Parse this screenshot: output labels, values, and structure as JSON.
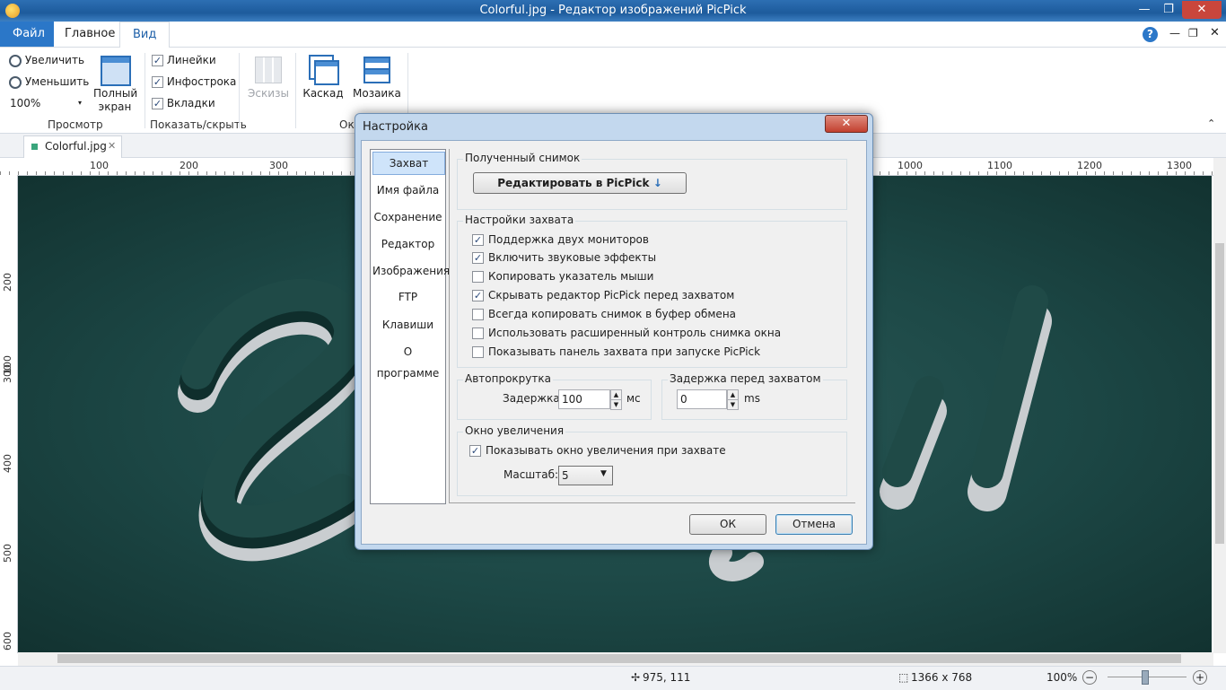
{
  "window": {
    "title": "Colorful.jpg - Редактор изображений PicPick",
    "minimize": "—",
    "restore": "❐",
    "close": "✕"
  },
  "menu": {
    "file": "Файл",
    "home": "Главное",
    "view": "Вид",
    "help": "?",
    "win_min": "—",
    "win_restore": "❐",
    "win_close": "✕",
    "collapse": "⌃"
  },
  "ribbon": {
    "zoom_in": "Увеличить",
    "zoom_out": "Уменьшить",
    "zoom_value": "100%",
    "fullscreen": "Полный экран",
    "view_group": "Просмотр",
    "rulers": "Линейки",
    "infobar": "Инфострока",
    "tabs": "Вкладки",
    "show_hide_group": "Показать/скрыть",
    "thumbnails": "Эскизы",
    "cascade": "Каскад",
    "tile": "Мозаика",
    "window_group": "Ок"
  },
  "doc_tab": {
    "name": "Colorful.jpg",
    "close": "✕"
  },
  "ruler": {
    "h": [
      "100",
      "200",
      "300",
      "1000",
      "1100",
      "1200",
      "1300"
    ],
    "v": [
      "100",
      "200",
      "300",
      "400",
      "500",
      "600"
    ]
  },
  "status": {
    "cursor": "975, 111",
    "size": "1366 x 768",
    "zoom": "100%",
    "minus": "−",
    "plus": "+"
  },
  "dialog": {
    "title": "Настройка",
    "close": "✕",
    "nav": [
      "Захват",
      "Имя файла",
      "Сохранение",
      "Редактор",
      "Изображения",
      "FTP",
      "Клавиши",
      "О программе"
    ],
    "received": {
      "legend": "Полученный снимок",
      "button": "Редактировать в PicPick",
      "arrow": "↓"
    },
    "capture": {
      "legend": "Настройки захвата",
      "options": [
        {
          "label": "Поддержка двух мониторов",
          "checked": true
        },
        {
          "label": "Включить звуковые эффекты",
          "checked": true
        },
        {
          "label": "Копировать указатель мыши",
          "checked": false
        },
        {
          "label": "Скрывать редактор PicPick перед захватом",
          "checked": true
        },
        {
          "label": "Всегда копировать снимок в буфер обмена",
          "checked": false
        },
        {
          "label": "Использовать расширенный контроль снимка окна",
          "checked": false
        },
        {
          "label": "Показывать панель захвата при запуске PicPick",
          "checked": false
        }
      ]
    },
    "autoscroll": {
      "legend": "Автопрокрутка",
      "label": "Задержка:",
      "value": "100",
      "unit": "мс"
    },
    "delay": {
      "legend": "Задержка перед захватом",
      "value": "0",
      "unit": "ms"
    },
    "magnifier": {
      "legend": "Окно увеличения",
      "option": "Показывать окно увеличения при захвате",
      "checked": true,
      "scale_label": "Масштаб:",
      "scale_value": "5"
    },
    "ok": "ОК",
    "cancel": "Отмена"
  },
  "colors": {
    "accent": "#2b77c8",
    "canvas": "#1c4745"
  }
}
